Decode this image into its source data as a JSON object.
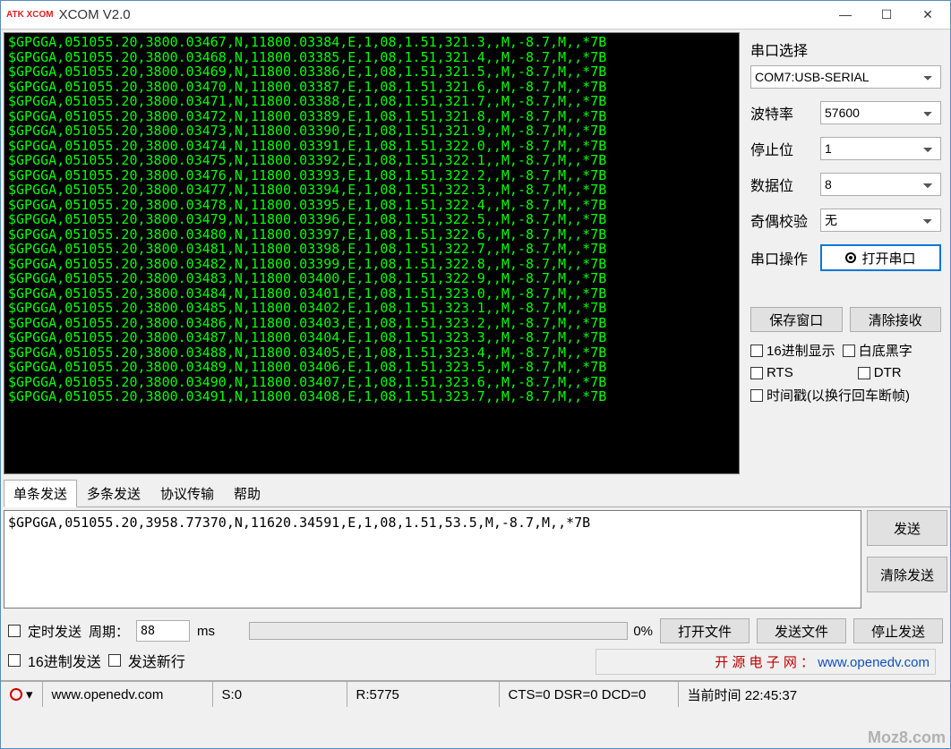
{
  "window": {
    "title": "XCOM V2.0",
    "logo": "ATK\nXCOM"
  },
  "terminal_lines": [
    "$GPGGA,051055.20,3800.03467,N,11800.03384,E,1,08,1.51,321.3,,M,-8.7,M,,*7B",
    "$GPGGA,051055.20,3800.03468,N,11800.03385,E,1,08,1.51,321.4,,M,-8.7,M,,*7B",
    "$GPGGA,051055.20,3800.03469,N,11800.03386,E,1,08,1.51,321.5,,M,-8.7,M,,*7B",
    "$GPGGA,051055.20,3800.03470,N,11800.03387,E,1,08,1.51,321.6,,M,-8.7,M,,*7B",
    "$GPGGA,051055.20,3800.03471,N,11800.03388,E,1,08,1.51,321.7,,M,-8.7,M,,*7B",
    "$GPGGA,051055.20,3800.03472,N,11800.03389,E,1,08,1.51,321.8,,M,-8.7,M,,*7B",
    "$GPGGA,051055.20,3800.03473,N,11800.03390,E,1,08,1.51,321.9,,M,-8.7,M,,*7B",
    "$GPGGA,051055.20,3800.03474,N,11800.03391,E,1,08,1.51,322.0,,M,-8.7,M,,*7B",
    "$GPGGA,051055.20,3800.03475,N,11800.03392,E,1,08,1.51,322.1,,M,-8.7,M,,*7B",
    "$GPGGA,051055.20,3800.03476,N,11800.03393,E,1,08,1.51,322.2,,M,-8.7,M,,*7B",
    "$GPGGA,051055.20,3800.03477,N,11800.03394,E,1,08,1.51,322.3,,M,-8.7,M,,*7B",
    "$GPGGA,051055.20,3800.03478,N,11800.03395,E,1,08,1.51,322.4,,M,-8.7,M,,*7B",
    "$GPGGA,051055.20,3800.03479,N,11800.03396,E,1,08,1.51,322.5,,M,-8.7,M,,*7B",
    "$GPGGA,051055.20,3800.03480,N,11800.03397,E,1,08,1.51,322.6,,M,-8.7,M,,*7B",
    "$GPGGA,051055.20,3800.03481,N,11800.03398,E,1,08,1.51,322.7,,M,-8.7,M,,*7B",
    "$GPGGA,051055.20,3800.03482,N,11800.03399,E,1,08,1.51,322.8,,M,-8.7,M,,*7B",
    "$GPGGA,051055.20,3800.03483,N,11800.03400,E,1,08,1.51,322.9,,M,-8.7,M,,*7B",
    "$GPGGA,051055.20,3800.03484,N,11800.03401,E,1,08,1.51,323.0,,M,-8.7,M,,*7B",
    "$GPGGA,051055.20,3800.03485,N,11800.03402,E,1,08,1.51,323.1,,M,-8.7,M,,*7B",
    "$GPGGA,051055.20,3800.03486,N,11800.03403,E,1,08,1.51,323.2,,M,-8.7,M,,*7B",
    "$GPGGA,051055.20,3800.03487,N,11800.03404,E,1,08,1.51,323.3,,M,-8.7,M,,*7B",
    "$GPGGA,051055.20,3800.03488,N,11800.03405,E,1,08,1.51,323.4,,M,-8.7,M,,*7B",
    "$GPGGA,051055.20,3800.03489,N,11800.03406,E,1,08,1.51,323.5,,M,-8.7,M,,*7B",
    "$GPGGA,051055.20,3800.03490,N,11800.03407,E,1,08,1.51,323.6,,M,-8.7,M,,*7B",
    "$GPGGA,051055.20,3800.03491,N,11800.03408,E,1,08,1.51,323.7,,M,-8.7,M,,*7B"
  ],
  "side": {
    "port_title": "串口选择",
    "port_value": "COM7:USB-SERIAL",
    "baud_label": "波特率",
    "baud_value": "57600",
    "stop_label": "停止位",
    "stop_value": "1",
    "data_label": "数据位",
    "data_value": "8",
    "parity_label": "奇偶校验",
    "parity_value": "无",
    "op_label": "串口操作",
    "op_button": "打开串口",
    "save_window": "保存窗口",
    "clear_recv": "清除接收",
    "hex_display": "16进制显示",
    "white_bg": "白底黑字",
    "rts": "RTS",
    "dtr": "DTR",
    "timestamp": "时间戳(以换行回车断帧)"
  },
  "tabs": {
    "t0": "单条发送",
    "t1": "多条发送",
    "t2": "协议传输",
    "t3": "帮助"
  },
  "send": {
    "text": "$GPGGA,051055.20,3958.77370,N,11620.34591,E,1,08,1.51,53.5,M,-8.7,M,,*7B",
    "send_btn": "发送",
    "clear_btn": "清除发送",
    "timed": "定时发送",
    "period_label": "周期：",
    "period_val": "88",
    "period_unit": "ms",
    "open_file": "打开文件",
    "send_file": "发送文件",
    "stop_send": "停止发送",
    "hex_send": "16进制发送",
    "send_newline": "发送新行",
    "progress": "0%"
  },
  "link": {
    "prefix": "开 源 电 子 网 ：",
    "url": "www.openedv.com"
  },
  "status": {
    "url": "www.openedv.com",
    "s": "S:0",
    "r": "R:5775",
    "ctl": "CTS=0 DSR=0 DCD=0",
    "time": "当前时间 22:45:37"
  },
  "watermark": "Moz8.com"
}
